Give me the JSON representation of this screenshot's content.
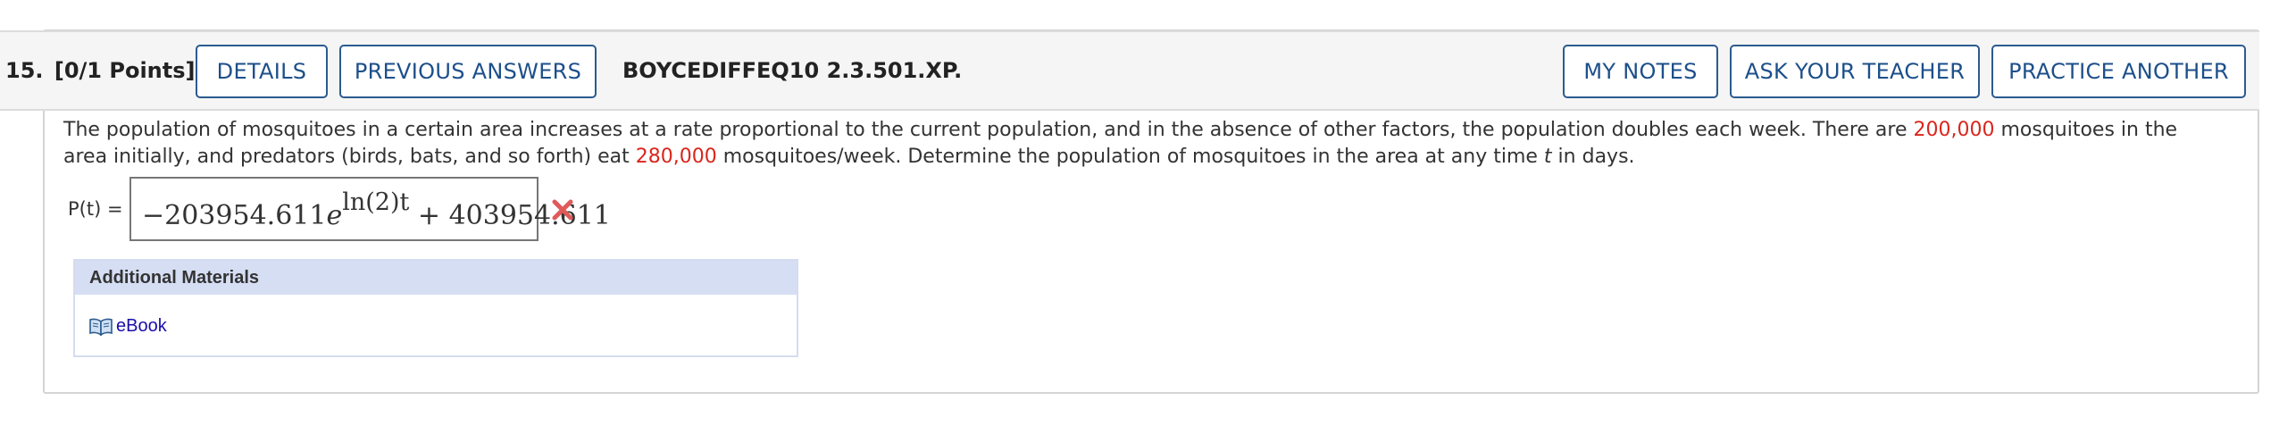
{
  "header": {
    "question_number": "15.",
    "points": "[0/1 Points]",
    "details_label": "DETAILS",
    "previous_answers_label": "PREVIOUS ANSWERS",
    "question_id": "BOYCEDIFFEQ10 2.3.501.XP.",
    "my_notes_label": "MY NOTES",
    "ask_teacher_label": "ASK YOUR TEACHER",
    "practice_another_label": "PRACTICE ANOTHER"
  },
  "question": {
    "text_1": "The population of mosquitoes in a certain area increases at a rate proportional to the current population, and in the absence of other factors, the population doubles each week. There are ",
    "initial_population": "200,000",
    "text_2": " mosquitoes in the area initially, and predators (birds, bats, and so forth) eat ",
    "eaten_per_week": "280,000",
    "text_3": " mosquitoes/week. Determine the population of mosquitoes in the area at any time ",
    "variable": "t",
    "text_4": " in days."
  },
  "answer": {
    "label": "P(t) =",
    "coefficient": "−203954.611",
    "base": "e",
    "exponent": "ln(2)t",
    "constant_term": "+ 403954.611",
    "status": "incorrect"
  },
  "materials": {
    "heading": "Additional Materials",
    "ebook_label": "eBook"
  },
  "colors": {
    "accent": "#1d4f8a",
    "highlight_red": "#d9261c",
    "materials_header": "#d6def4",
    "incorrect_mark": "#e05a5a"
  }
}
